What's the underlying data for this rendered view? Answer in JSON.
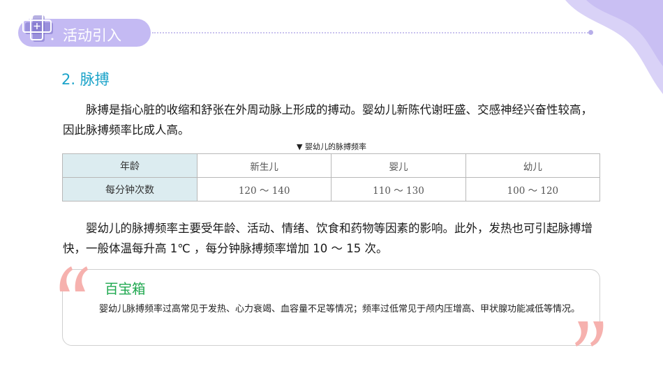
{
  "header": {
    "title": "活动引入",
    "icon": "medical-cross-icon"
  },
  "section": {
    "heading": "2. 脉搏"
  },
  "paragraphs": {
    "intro": "脉搏是指心脏的收缩和舒张在外周动脉上形成的搏动。婴幼儿新陈代谢旺盛、交感神经兴奋性较高，因此脉搏频率比成人高。",
    "factors": "婴幼儿的脉搏频率主要受年龄、活动、情绪、饮食和药物等因素的影响。此外，发热也可引起脉搏增快，一般体温每升高 1℃ ，每分钟脉搏频率增加 10 ～ 15 次。"
  },
  "table": {
    "caption": "▼  婴幼儿的脉搏频率",
    "header_label": "年龄",
    "row_label": "每分钟次数",
    "columns": [
      "新生儿",
      "婴儿",
      "幼儿"
    ],
    "values": [
      "120 ～ 140",
      "110 ～ 130",
      "100 ～ 120"
    ]
  },
  "tip": {
    "title": "百宝箱",
    "text": "婴幼儿脉搏频率过高常见于发热、心力衰竭、血容量不足等情况；频率过低常见于颅内压增高、甲状腺功能减低等情况。"
  },
  "colors": {
    "accent_purple": "#c4baf3",
    "heading_blue": "#1aa3c9",
    "tip_green": "#1fa84f",
    "quote_pink": "#f6b1ae",
    "table_label_bg": "#dcecf0"
  }
}
